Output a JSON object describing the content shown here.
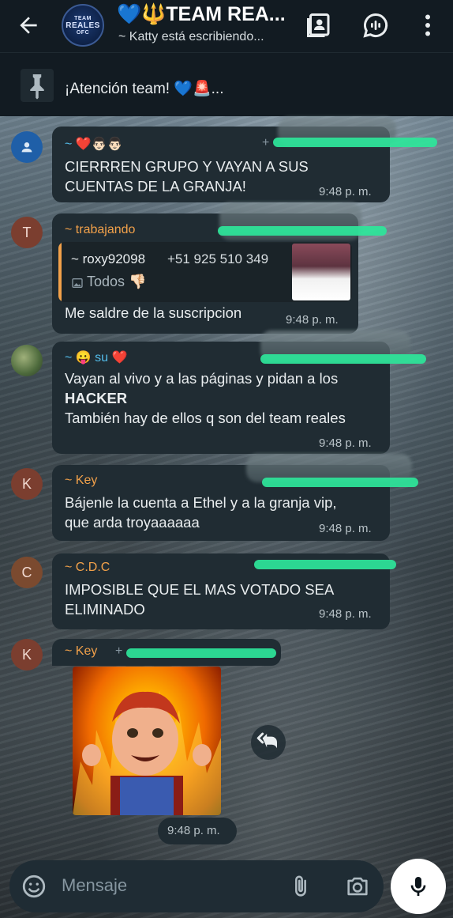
{
  "header": {
    "group_avatar_text_top": "TEAM",
    "group_avatar_text_main": "REALES",
    "group_avatar_text_bottom": "OFC",
    "title": "💙🔱TEAM REA...",
    "subtitle": "~ Katty está escribiendo..."
  },
  "pinned": {
    "text": "¡Atención team! 💙🚨..."
  },
  "messages": [
    {
      "sender": "~ ❤️👨🏻👨🏻",
      "lines": [
        "CIERRREN GRUPO Y VAYAN A SUS",
        "CUENTAS DE LA GRANJA!"
      ],
      "time": "9:48 p. m."
    },
    {
      "avatar_letter": "T",
      "sender": "~ trabajando",
      "quote_sender": "~ roxy92098",
      "quote_phone": "+51 925 510 349",
      "quote_text": "Todos 👎🏻",
      "text": "Me saldre de la suscripcion",
      "time": "9:48 p. m."
    },
    {
      "sender": "~ 😛 su ❤️",
      "line1": "Vayan al vivo y a las páginas y pidan a los",
      "line2": "HACKER",
      "line3": "También hay de ellos q son del team reales",
      "time": "9:48 p. m."
    },
    {
      "avatar_letter": "K",
      "sender": "~ Key",
      "lines": [
        "Bájenle la cuenta a Ethel y a la granja vip,",
        "que arda troyaaaaaa"
      ],
      "time": "9:48 p. m."
    },
    {
      "avatar_letter": "C",
      "sender": "~ C.D.C",
      "lines": [
        "IMPOSIBLE QUE EL MAS VOTADO SEA",
        "ELIMINADO"
      ],
      "time": "9:48 p. m."
    },
    {
      "avatar_letter": "K",
      "sender": "~ Key",
      "time": "9:48 p. m."
    }
  ],
  "input": {
    "placeholder": "Mensaje"
  },
  "colors": {
    "sender_orange": "#f2a14a",
    "sender_green": "#53bdeb",
    "highlighter": "#2ee69a",
    "bubble": "#202c33"
  }
}
